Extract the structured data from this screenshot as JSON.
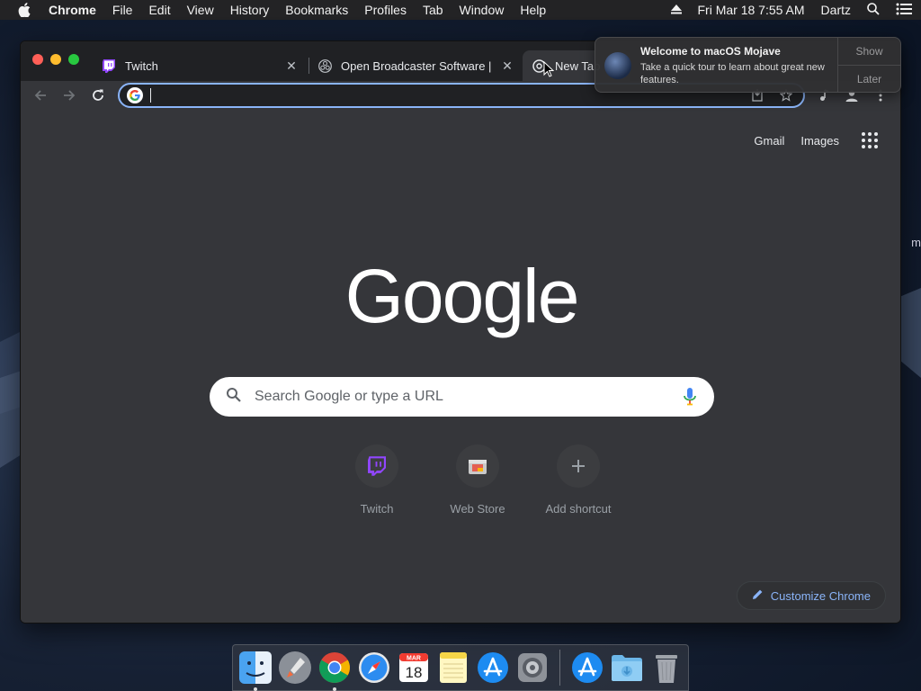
{
  "menubar": {
    "app_name": "Chrome",
    "items": [
      "File",
      "Edit",
      "View",
      "History",
      "Bookmarks",
      "Profiles",
      "Tab",
      "Window",
      "Help"
    ],
    "datetime": "Fri Mar 18  7:55 AM",
    "user": "Dartz"
  },
  "tabs": [
    {
      "title": "Twitch",
      "icon": "twitch-icon"
    },
    {
      "title": "Open Broadcaster Software | O",
      "icon": "obs-icon"
    },
    {
      "title": "New Tab",
      "icon": "chrome-icon"
    }
  ],
  "omnibox": {
    "value": ""
  },
  "newtab": {
    "links": {
      "gmail": "Gmail",
      "images": "Images"
    },
    "logo_text": "Google",
    "search_placeholder": "Search Google or type a URL",
    "shortcuts": [
      {
        "name": "Twitch",
        "icon": "twitch-icon"
      },
      {
        "name": "Web Store",
        "icon": "web-store-icon"
      },
      {
        "name": "Add shortcut",
        "icon": "plus-icon"
      }
    ],
    "customize_label": "Customize Chrome"
  },
  "notification": {
    "title": "Welcome to macOS Mojave",
    "body": "Take a quick tour to learn about great new features.",
    "show_label": "Show",
    "later_label": "Later"
  },
  "dock": {
    "calendar_month": "MAR",
    "calendar_day": "18",
    "items": [
      "finder-icon",
      "launchpad-icon",
      "chrome-icon",
      "safari-icon",
      "calendar-icon",
      "notes-icon",
      "app-store-icon",
      "system-preferences-icon",
      "app-store-icon",
      "downloads-folder-icon",
      "trash-icon"
    ]
  },
  "desktop": {
    "fragment": "m"
  },
  "colors": {
    "accent": "#8ab4f8",
    "window_bg": "#35363a",
    "tabstrip_bg": "#202124"
  }
}
